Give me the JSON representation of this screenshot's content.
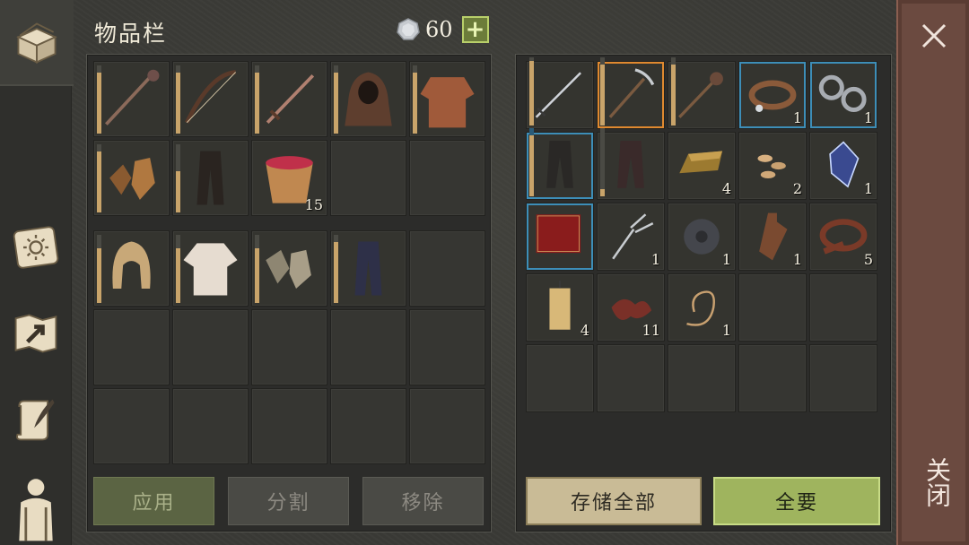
{
  "header": {
    "title": "物品栏",
    "currency": "60",
    "plus_label": "+"
  },
  "nav": {
    "items": [
      {
        "name": "inventory-chest-icon",
        "active": true
      },
      {
        "name": "sun-book-icon",
        "active": false
      },
      {
        "name": "map-arrow-icon",
        "active": false
      },
      {
        "name": "scroll-quill-icon",
        "active": false
      },
      {
        "name": "character-backpack-icon",
        "active": false
      }
    ]
  },
  "inventory": {
    "top": [
      {
        "icon": "mace-icon",
        "qty": "",
        "durability": 0.9
      },
      {
        "icon": "bow-icon",
        "qty": "",
        "durability": 0.9
      },
      {
        "icon": "sword-icon",
        "qty": "",
        "durability": 0.9
      },
      {
        "icon": "hood-cloak-icon",
        "qty": "",
        "durability": 0.9
      },
      {
        "icon": "chainmail-icon",
        "qty": "",
        "durability": 0.9
      },
      {
        "icon": "leather-gloves-icon",
        "qty": "",
        "durability": 0.9
      },
      {
        "icon": "leather-pants-icon",
        "qty": "",
        "durability": 0.6
      },
      {
        "icon": "berry-bucket-icon",
        "qty": "15",
        "durability": null
      },
      {
        "icon": "",
        "qty": "",
        "durability": null
      },
      {
        "icon": "",
        "qty": "",
        "durability": null
      }
    ],
    "equip": [
      {
        "icon": "cloth-hood-icon",
        "qty": "",
        "durability": 0.8
      },
      {
        "icon": "cloth-shirt-icon",
        "qty": "",
        "durability": 0.8
      },
      {
        "icon": "cloth-gloves-icon",
        "qty": "",
        "durability": 0.8
      },
      {
        "icon": "cloth-pants-icon",
        "qty": "",
        "durability": 0.9
      },
      {
        "icon": "",
        "qty": "",
        "durability": null
      }
    ]
  },
  "storage": [
    {
      "icon": "longsword-icon",
      "qty": "",
      "durability": 0.95,
      "frame": ""
    },
    {
      "icon": "pickaxe-icon",
      "qty": "",
      "durability": 0.9,
      "frame": "orange"
    },
    {
      "icon": "spiked-mace-icon",
      "qty": "",
      "durability": 0.9,
      "frame": ""
    },
    {
      "icon": "collar-icon",
      "qty": "1",
      "durability": null,
      "frame": "blue"
    },
    {
      "icon": "shackles-icon",
      "qty": "1",
      "durability": null,
      "frame": "blue"
    },
    {
      "icon": "armored-pants-icon",
      "qty": "",
      "durability": 0.9,
      "frame": "blue"
    },
    {
      "icon": "dark-pants-icon",
      "qty": "",
      "durability": 0.1,
      "frame": ""
    },
    {
      "icon": "gold-ingot-icon",
      "qty": "4",
      "durability": null,
      "frame": ""
    },
    {
      "icon": "seeds-icon",
      "qty": "2",
      "durability": null,
      "frame": ""
    },
    {
      "icon": "crystal-icon",
      "qty": "1",
      "durability": null,
      "frame": ""
    },
    {
      "icon": "red-book-icon",
      "qty": "",
      "durability": null,
      "frame": "blue"
    },
    {
      "icon": "fork-tool-icon",
      "qty": "1",
      "durability": null,
      "frame": ""
    },
    {
      "icon": "gear-icon",
      "qty": "1",
      "durability": null,
      "frame": ""
    },
    {
      "icon": "bottle-icon",
      "qty": "1",
      "durability": null,
      "frame": ""
    },
    {
      "icon": "leather-roll-icon",
      "qty": "5",
      "durability": null,
      "frame": ""
    },
    {
      "icon": "candle-icon",
      "qty": "4",
      "durability": null,
      "frame": ""
    },
    {
      "icon": "meat-scraps-icon",
      "qty": "11",
      "durability": null,
      "frame": ""
    },
    {
      "icon": "rope-icon",
      "qty": "1",
      "durability": null,
      "frame": ""
    }
  ],
  "buttons": {
    "apply": "应用",
    "split": "分割",
    "remove": "移除",
    "store_all": "存储全部",
    "take_all": "全要",
    "close": "关闭"
  }
}
